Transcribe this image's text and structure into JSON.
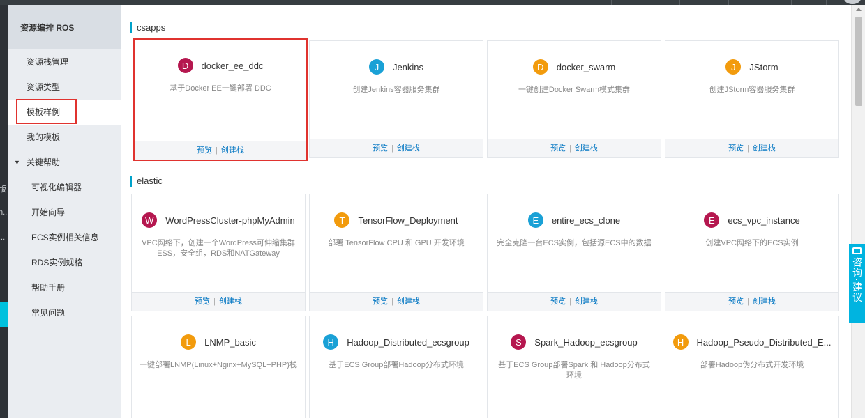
{
  "left_strip": {
    "fragments": [
      "版",
      "n...",
      "..."
    ]
  },
  "sidebar": {
    "header": "资源编排 ROS",
    "items": [
      {
        "label": "资源栈管理"
      },
      {
        "label": "资源类型"
      },
      {
        "label": "模板样例",
        "active": true
      },
      {
        "label": "我的模板"
      },
      {
        "label": "关键帮助",
        "expanded": true
      }
    ],
    "subitems": [
      {
        "label": "可视化编辑器"
      },
      {
        "label": "开始向导"
      },
      {
        "label": "ECS实例相关信息"
      },
      {
        "label": "RDS实例规格"
      },
      {
        "label": "帮助手册"
      },
      {
        "label": "常见问题"
      }
    ]
  },
  "sections": [
    {
      "title": "csapps",
      "cards": [
        {
          "letter": "D",
          "color": "#b5174f",
          "name": "docker_ee_ddc",
          "desc": "基于Docker EE一键部署 DDC",
          "preview": "预览",
          "create": "创建栈"
        },
        {
          "letter": "J",
          "color": "#1aa1d6",
          "name": "Jenkins",
          "desc": "创建Jenkins容器服务集群",
          "preview": "预览",
          "create": "创建栈"
        },
        {
          "letter": "D",
          "color": "#f29b0d",
          "name": "docker_swarm",
          "desc": "一键创建Docker Swarm模式集群",
          "preview": "预览",
          "create": "创建栈"
        },
        {
          "letter": "J",
          "color": "#f29b0d",
          "name": "JStorm",
          "desc": "创建JStorm容器服务集群",
          "preview": "预览",
          "create": "创建栈"
        }
      ]
    },
    {
      "title": "elastic",
      "cards": [
        {
          "letter": "W",
          "color": "#b5174f",
          "name": "WordPressCluster-phpMyAdmin",
          "desc": "VPC网络下，创建一个WordPress可伸缩集群 ESS，安全组，RDS和NATGateway",
          "preview": "预览",
          "create": "创建栈"
        },
        {
          "letter": "T",
          "color": "#f29b0d",
          "name": "TensorFlow_Deployment",
          "desc": "部署 TensorFlow CPU 和 GPU 开发环境",
          "preview": "预览",
          "create": "创建栈"
        },
        {
          "letter": "E",
          "color": "#1aa1d6",
          "name": "entire_ecs_clone",
          "desc": "完全克隆一台ECS实例，包括源ECS中的数据",
          "preview": "预览",
          "create": "创建栈"
        },
        {
          "letter": "E",
          "color": "#b5174f",
          "name": "ecs_vpc_instance",
          "desc": "创建VPC网络下的ECS实例",
          "preview": "预览",
          "create": "创建栈"
        }
      ]
    },
    {
      "title": "",
      "cards": [
        {
          "letter": "L",
          "color": "#f29b0d",
          "name": "LNMP_basic",
          "desc": "一键部署LNMP(Linux+Nginx+MySQL+PHP)栈"
        },
        {
          "letter": "H",
          "color": "#1aa1d6",
          "name": "Hadoop_Distributed_ecsgroup",
          "desc": "基于ECS Group部署Hadoop分布式环境"
        },
        {
          "letter": "S",
          "color": "#b5174f",
          "name": "Spark_Hadoop_ecsgroup",
          "desc": "基于ECS Group部署Spark 和 Hadoop分布式环境"
        },
        {
          "letter": "H",
          "color": "#f29b0d",
          "name": "Hadoop_Pseudo_Distributed_E...",
          "desc": "部署Hadoop伪分布式开发环境"
        }
      ]
    }
  ],
  "consult": {
    "label": "咨询·建议"
  },
  "colors": {
    "accent": "#00a2ca",
    "link": "#0075c2",
    "highlight": "#e0332f"
  }
}
